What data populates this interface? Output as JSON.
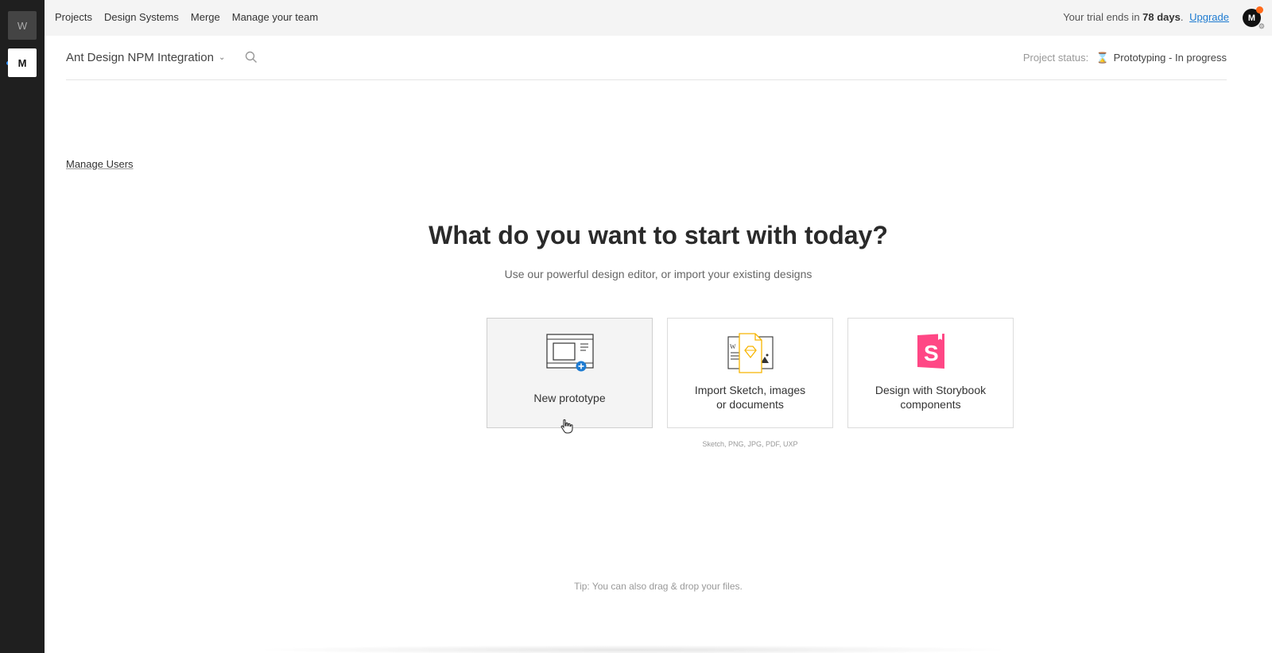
{
  "workspaces": [
    {
      "letter": "W",
      "active": false
    },
    {
      "letter": "M",
      "active": true
    }
  ],
  "topnav": {
    "items": [
      "Projects",
      "Design Systems",
      "Merge",
      "Manage your team"
    ],
    "trial_prefix": "Your trial ends in",
    "trial_days": "78 days",
    "trial_suffix": ".",
    "upgrade": "Upgrade",
    "avatar_letter": "M"
  },
  "project": {
    "name": "Ant Design NPM Integration",
    "status_label": "Project status:",
    "status_value": "Prototyping - In progress"
  },
  "manage_users": "Manage Users",
  "hero": {
    "title": "What do you want to start with today?",
    "subtitle": "Use our powerful design editor, or import your existing designs"
  },
  "cards": [
    {
      "label": "New prototype",
      "icon": "new-prototype-icon"
    },
    {
      "label_line1": "Import Sketch, images",
      "label_line2": "or documents",
      "icon": "import-files-icon"
    },
    {
      "label_line1": "Design with Storybook",
      "label_line2": "components",
      "icon": "storybook-icon"
    }
  ],
  "import_formats": "Sketch, PNG, JPG, PDF, UXP",
  "tip": "Tip: You can also drag & drop your files.",
  "colors": {
    "accent": "#1e7bd1",
    "storybook": "#ff4785",
    "sketch": "#f7b500",
    "notification": "#ff6a1a",
    "rail": "#1f1f1f"
  }
}
